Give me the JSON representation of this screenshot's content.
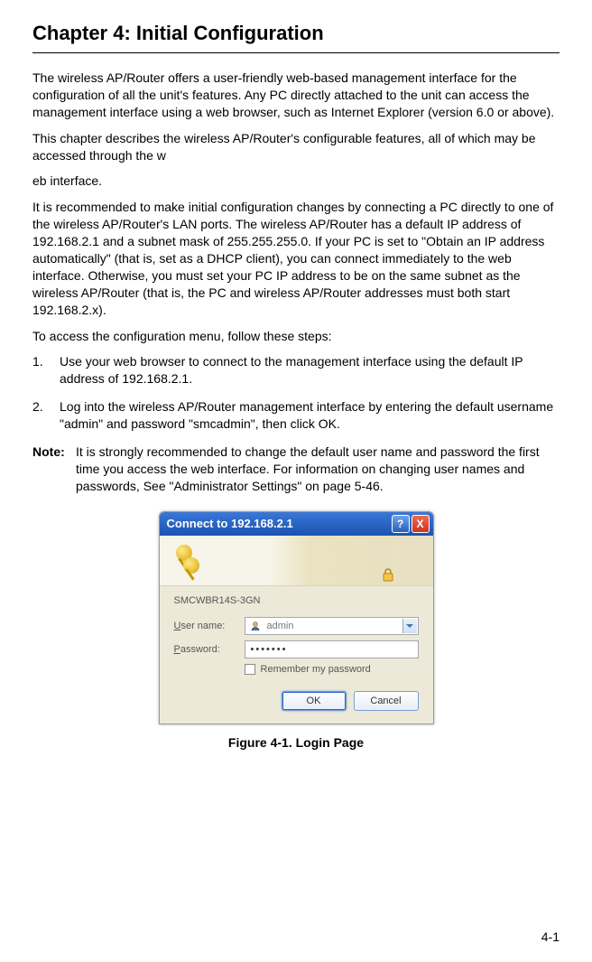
{
  "chapter_title": "Chapter 4: Initial Configuration",
  "paragraphs": {
    "p1": "The wireless AP/Router offers a user-friendly web-based management interface for the configuration of all the unit's features. Any PC directly attached to the unit can access the management interface using a web browser, such as Internet Explorer (version 6.0 or above).",
    "p2": "This chapter describes the wireless AP/Router's configurable features, all of which may be accessed through the w",
    "p3": "eb interface.",
    "p4": "It is recommended to make initial configuration changes by connecting a PC directly to one of the wireless AP/Router's LAN ports. The wireless AP/Router has a default IP address of 192.168.2.1 and a subnet mask of 255.255.255.0. If your PC is set to \"Obtain an IP address automatically\" (that is, set as a DHCP client), you can connect immediately to the web interface. Otherwise, you must set your PC IP address to be on the same subnet as the wireless AP/Router (that is, the PC and wireless AP/Router addresses must both start 192.168.2.x).",
    "p5": "To access the configuration menu, follow these steps:"
  },
  "steps": [
    {
      "num": "1.",
      "text": "Use your web browser to connect to the management interface using the default IP address of 192.168.2.1."
    },
    {
      "num": "2.",
      "text": "Log into the wireless AP/Router management interface by entering the default username \"admin\" and password \"smcadmin\", then click OK."
    }
  ],
  "note": {
    "label": "Note:",
    "text": "It is strongly recommended to change the default user name and password the first time you access the web interface. For information on changing user names and passwords, See \"Administrator Settings\" on page 5-46."
  },
  "dialog": {
    "title": "Connect to 192.168.2.1",
    "help_symbol": "?",
    "close_symbol": "X",
    "realm": "SMCWBR14S-3GN",
    "username_label_pre": "U",
    "username_label_rest": "ser name:",
    "username_value": "admin",
    "password_label_pre": "P",
    "password_label_rest": "assword:",
    "password_value": "•••••••",
    "remember_pre": "R",
    "remember_rest": "emember my password",
    "ok": "OK",
    "cancel": "Cancel"
  },
  "figure_caption": "Figure 4-1.   Login Page",
  "page_number": "4-1"
}
